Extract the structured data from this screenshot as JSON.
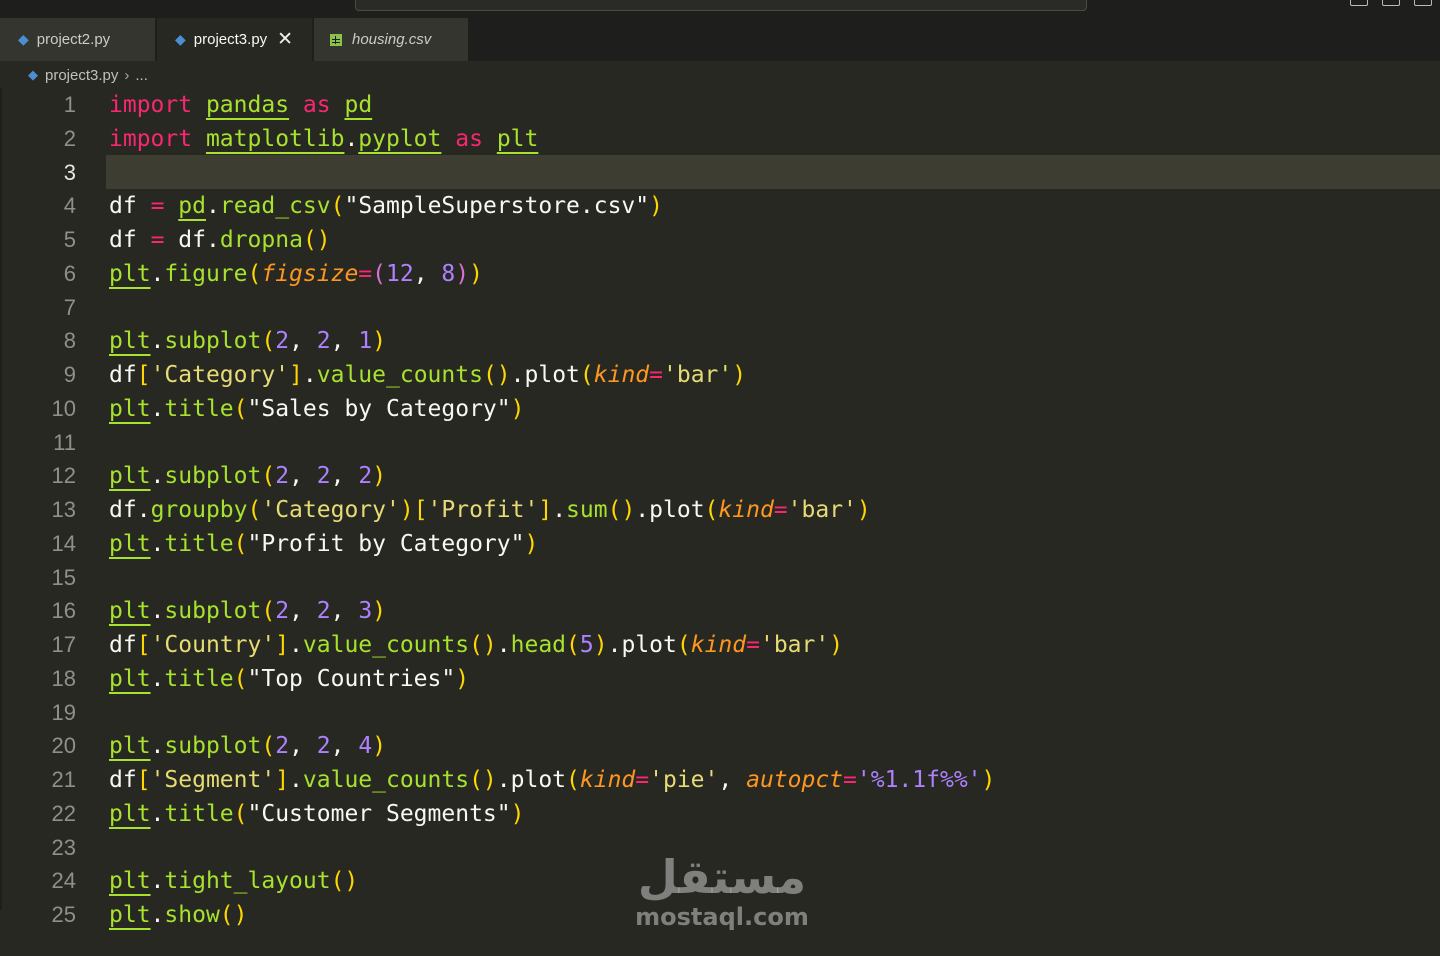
{
  "tabs": [
    {
      "label": "project2.py",
      "active": false,
      "icon": "python-icon"
    },
    {
      "label": "project3.py",
      "active": true,
      "icon": "python-icon",
      "close": "✕"
    },
    {
      "label": "housing.csv",
      "active": false,
      "icon": "csv-table-icon"
    }
  ],
  "breadcrumb": {
    "file": "project3.py",
    "more": "..."
  },
  "lines": [
    "1",
    "2",
    "3",
    "4",
    "5",
    "6",
    "7",
    "8",
    "9",
    "10",
    "11",
    "12",
    "13",
    "14",
    "15",
    "16",
    "17",
    "18",
    "19",
    "20",
    "21",
    "22",
    "23",
    "24",
    "25"
  ],
  "code": {
    "import_kw": "import",
    "as_kw": "as",
    "pandas": "pandas",
    "pd": "pd",
    "matplotlib": "matplotlib",
    "pyplot": "pyplot",
    "plt": "plt",
    "df": "df",
    "read_csv": "read_csv",
    "csv_file": "\"SampleSuperstore.csv\"",
    "dropna": "dropna",
    "figure": "figure",
    "figsize": "figsize",
    "subplot": "subplot",
    "value_counts": "value_counts",
    "plot": "plot",
    "kind": "kind",
    "bar": "'bar'",
    "pie": "'pie'",
    "title": "title",
    "groupby": "groupby",
    "sum": "sum",
    "head": "head",
    "autopct": "autopct",
    "autopct_val": "'%1.1f%%'",
    "tight_layout": "tight_layout",
    "show": "show",
    "category_key": "'Category'",
    "profit_key": "'Profit'",
    "country_key": "'Country'",
    "segment_key": "'Segment'",
    "t_sales": "\"Sales by Category\"",
    "t_profit": "\"Profit by Category\"",
    "t_countries": "\"Top Countries\"",
    "t_segments": "\"Customer Segments\""
  },
  "watermark": {
    "arabic": "مستقل",
    "latin": "mostaql.com"
  }
}
